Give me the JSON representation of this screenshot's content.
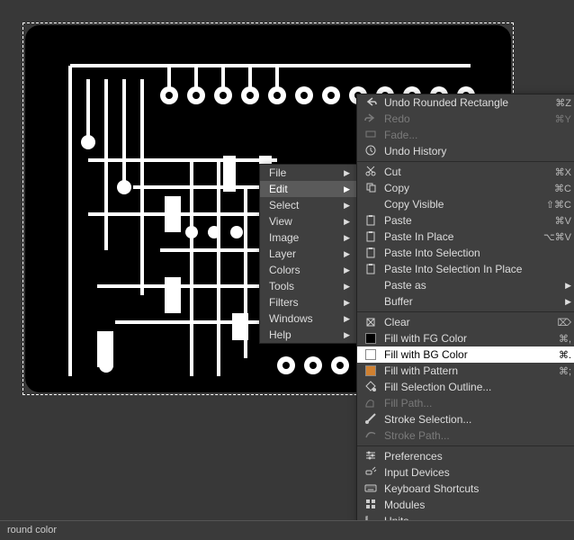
{
  "status_bar": {
    "text": "round color"
  },
  "menu_main": {
    "items": [
      {
        "label": "File",
        "has_sub": true
      },
      {
        "label": "Edit",
        "has_sub": true,
        "hover": true
      },
      {
        "label": "Select",
        "has_sub": true
      },
      {
        "label": "View",
        "has_sub": true
      },
      {
        "label": "Image",
        "has_sub": true
      },
      {
        "label": "Layer",
        "has_sub": true
      },
      {
        "label": "Colors",
        "has_sub": true
      },
      {
        "label": "Tools",
        "has_sub": true
      },
      {
        "label": "Filters",
        "has_sub": true
      },
      {
        "label": "Windows",
        "has_sub": true
      },
      {
        "label": "Help",
        "has_sub": true
      }
    ]
  },
  "menu_edit": {
    "items": [
      {
        "icon": "undo",
        "label": "Undo Rounded Rectangle",
        "shortcut": "⌘Z"
      },
      {
        "icon": "redo",
        "label": "Redo",
        "shortcut": "⌘Y",
        "disabled": true
      },
      {
        "icon": "fade",
        "label": "Fade...",
        "disabled": true
      },
      {
        "icon": "history",
        "label": "Undo History"
      },
      {
        "sep": true
      },
      {
        "icon": "cut",
        "label": "Cut",
        "shortcut": "⌘X"
      },
      {
        "icon": "copy",
        "label": "Copy",
        "shortcut": "⌘C"
      },
      {
        "label": "Copy Visible",
        "shortcut": "⇧⌘C"
      },
      {
        "icon": "paste",
        "label": "Paste",
        "shortcut": "⌘V"
      },
      {
        "icon": "paste",
        "label": "Paste In Place",
        "shortcut": "⌥⌘V"
      },
      {
        "icon": "paste",
        "label": "Paste Into Selection"
      },
      {
        "icon": "paste",
        "label": "Paste Into Selection In Place"
      },
      {
        "label": "Paste as",
        "has_sub": true
      },
      {
        "label": "Buffer",
        "has_sub": true
      },
      {
        "sep": true
      },
      {
        "icon": "clear",
        "label": "Clear",
        "shortcut": "⌦"
      },
      {
        "swatch": "fg",
        "label": "Fill with FG Color",
        "shortcut": "⌘,"
      },
      {
        "swatch": "bg",
        "label": "Fill with BG Color",
        "shortcut": "⌘.",
        "hover": true
      },
      {
        "swatch": "pat",
        "label": "Fill with Pattern",
        "shortcut": "⌘;"
      },
      {
        "icon": "fillsel",
        "label": "Fill Selection Outline..."
      },
      {
        "icon": "fillpath",
        "label": "Fill Path...",
        "disabled": true
      },
      {
        "icon": "stroke",
        "label": "Stroke Selection..."
      },
      {
        "icon": "strokepath",
        "label": "Stroke Path...",
        "disabled": true
      },
      {
        "sep": true
      },
      {
        "icon": "prefs",
        "label": "Preferences"
      },
      {
        "icon": "input",
        "label": "Input Devices"
      },
      {
        "icon": "keyboard",
        "label": "Keyboard Shortcuts"
      },
      {
        "icon": "modules",
        "label": "Modules"
      },
      {
        "icon": "units",
        "label": "Units"
      }
    ]
  }
}
